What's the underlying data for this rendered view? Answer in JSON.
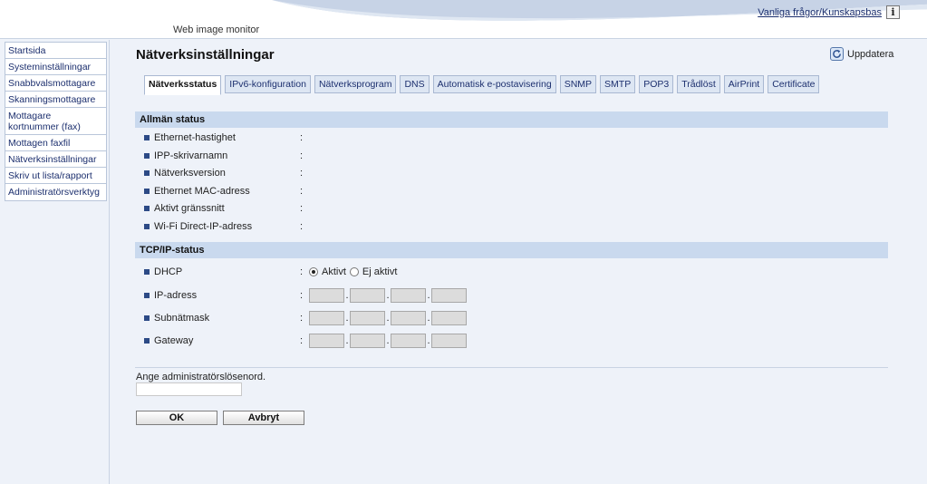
{
  "header": {
    "app_title": "Web image monitor",
    "faq_link": "Vanliga frågor/Kunskapsbas",
    "info_icon": "i"
  },
  "sidebar": {
    "items": [
      {
        "label": "Startsida"
      },
      {
        "label": "Systeminställningar"
      },
      {
        "label": "Snabbvalsmottagare"
      },
      {
        "label": "Skanningsmottagare"
      },
      {
        "label": "Mottagare kortnummer (fax)"
      },
      {
        "label": "Mottagen faxfil"
      },
      {
        "label": "Nätverksinställningar"
      },
      {
        "label": "Skriv ut lista/rapport"
      },
      {
        "label": "Administratörsverktyg"
      }
    ]
  },
  "main": {
    "title": "Nätverksinställningar",
    "refresh_label": "Uppdatera",
    "tabs": [
      {
        "label": "Nätverksstatus",
        "active": true
      },
      {
        "label": "IPv6-konfiguration"
      },
      {
        "label": "Nätverksprogram"
      },
      {
        "label": "DNS"
      },
      {
        "label": "Automatisk e-postavisering"
      },
      {
        "label": "SNMP"
      },
      {
        "label": "SMTP"
      },
      {
        "label": "POP3"
      },
      {
        "label": "Trådlöst"
      },
      {
        "label": "AirPrint"
      },
      {
        "label": "Certificate"
      }
    ],
    "general_status": {
      "heading": "Allmän status",
      "rows": [
        {
          "label": "Ethernet-hastighet",
          "value": ""
        },
        {
          "label": "IPP-skrivarnamn",
          "value": ""
        },
        {
          "label": "Nätverksversion",
          "value": ""
        },
        {
          "label": "Ethernet MAC-adress",
          "value": ""
        },
        {
          "label": "Aktivt gränssnitt",
          "value": ""
        },
        {
          "label": "Wi-Fi Direct-IP-adress",
          "value": ""
        }
      ]
    },
    "tcpip_status": {
      "heading": "TCP/IP-status",
      "dhcp": {
        "label": "DHCP",
        "option_active": "Aktivt",
        "option_inactive": "Ej aktivt",
        "selected": "Aktivt"
      },
      "ip_address": {
        "label": "IP-adress",
        "octets": [
          "",
          "",
          "",
          ""
        ]
      },
      "subnet_mask": {
        "label": "Subnätmask",
        "octets": [
          "",
          "",
          "",
          ""
        ]
      },
      "gateway": {
        "label": "Gateway",
        "octets": [
          "",
          "",
          "",
          ""
        ]
      }
    },
    "separator_colon": ":",
    "octet_dot": ".",
    "password": {
      "label": "Ange administratörslösenord.",
      "value": ""
    },
    "ok_label": "OK",
    "cancel_label": "Avbryt"
  },
  "colors": {
    "background": "#eef2f9",
    "section_bar": "#c9d9ee",
    "tab_inactive": "#dde6f3",
    "link": "#1c2f6e",
    "bullet": "#2c4a86"
  }
}
